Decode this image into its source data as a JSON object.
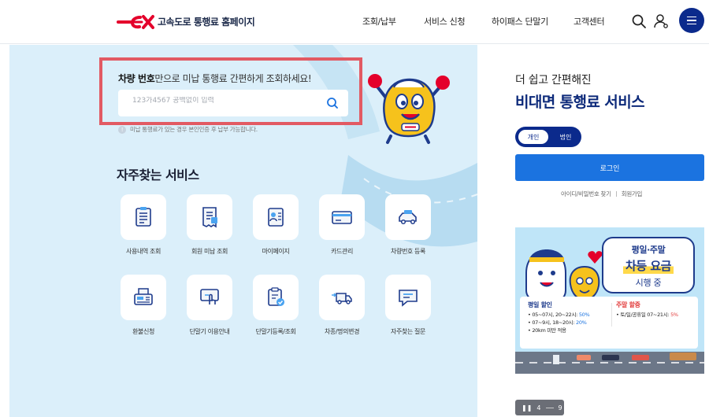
{
  "header": {
    "logo_text": "고속도로 통행료 홈페이지",
    "nav": [
      "조회/납부",
      "서비스 신청",
      "하이패스 단말기",
      "고객센터"
    ]
  },
  "lookup": {
    "title_bold": "차량 번호",
    "title_rest": "만으로 미납 통행료 간편하게 조회하세요!",
    "placeholder": "123가4567 공백없이 입력",
    "notice": "미납 통행료가 있는 경우 본인인증 후 납부 가능합니다."
  },
  "favorites": {
    "title": "자주찾는 서비스",
    "items": [
      {
        "label": "사용내역 조회",
        "icon": "document-list-icon"
      },
      {
        "label": "회원 미납 조회",
        "icon": "receipt-icon"
      },
      {
        "label": "마이페이지",
        "icon": "id-card-icon"
      },
      {
        "label": "카드관리",
        "icon": "credit-card-icon"
      },
      {
        "label": "차량번호 등록",
        "icon": "car-icon"
      },
      {
        "label": "환불신청",
        "icon": "fax-printer-icon"
      },
      {
        "label": "단말기 이용안내",
        "icon": "touch-screen-icon"
      },
      {
        "label": "단말기등록/조회",
        "icon": "clipboard-check-icon"
      },
      {
        "label": "차종/명의변경",
        "icon": "truck-change-icon"
      },
      {
        "label": "자주찾는 질문",
        "icon": "chat-question-icon"
      }
    ]
  },
  "right": {
    "subtitle": "더 쉽고 간편해진",
    "title": "비대면 통행료 서비스",
    "toggle_on": "개인",
    "toggle_off": "법인",
    "login": "로그인",
    "link_find": "아이디/비밀번호 찾기",
    "link_join": "회원가입"
  },
  "banner": {
    "line1": "평일·주말",
    "line2": "차등 요금",
    "line3": "시행 중",
    "weekday_head": "평일 할인",
    "weekday_1a": "05~07시, 20~22시: ",
    "weekday_1b": "50%",
    "weekday_2a": "07~9시, 18~20시: ",
    "weekday_2b": "20%",
    "weekday_3": "20km 미만 적용",
    "weekend_head": "주말 할증",
    "weekend_1a": "토/일/공휴일 07~21시: ",
    "weekend_1b": "5%"
  },
  "pager": {
    "current": "4",
    "total": "9"
  },
  "colors": {
    "accent": "#0b2a8c",
    "primary_button": "#1b73e0",
    "highlight_border": "#e25a63"
  }
}
